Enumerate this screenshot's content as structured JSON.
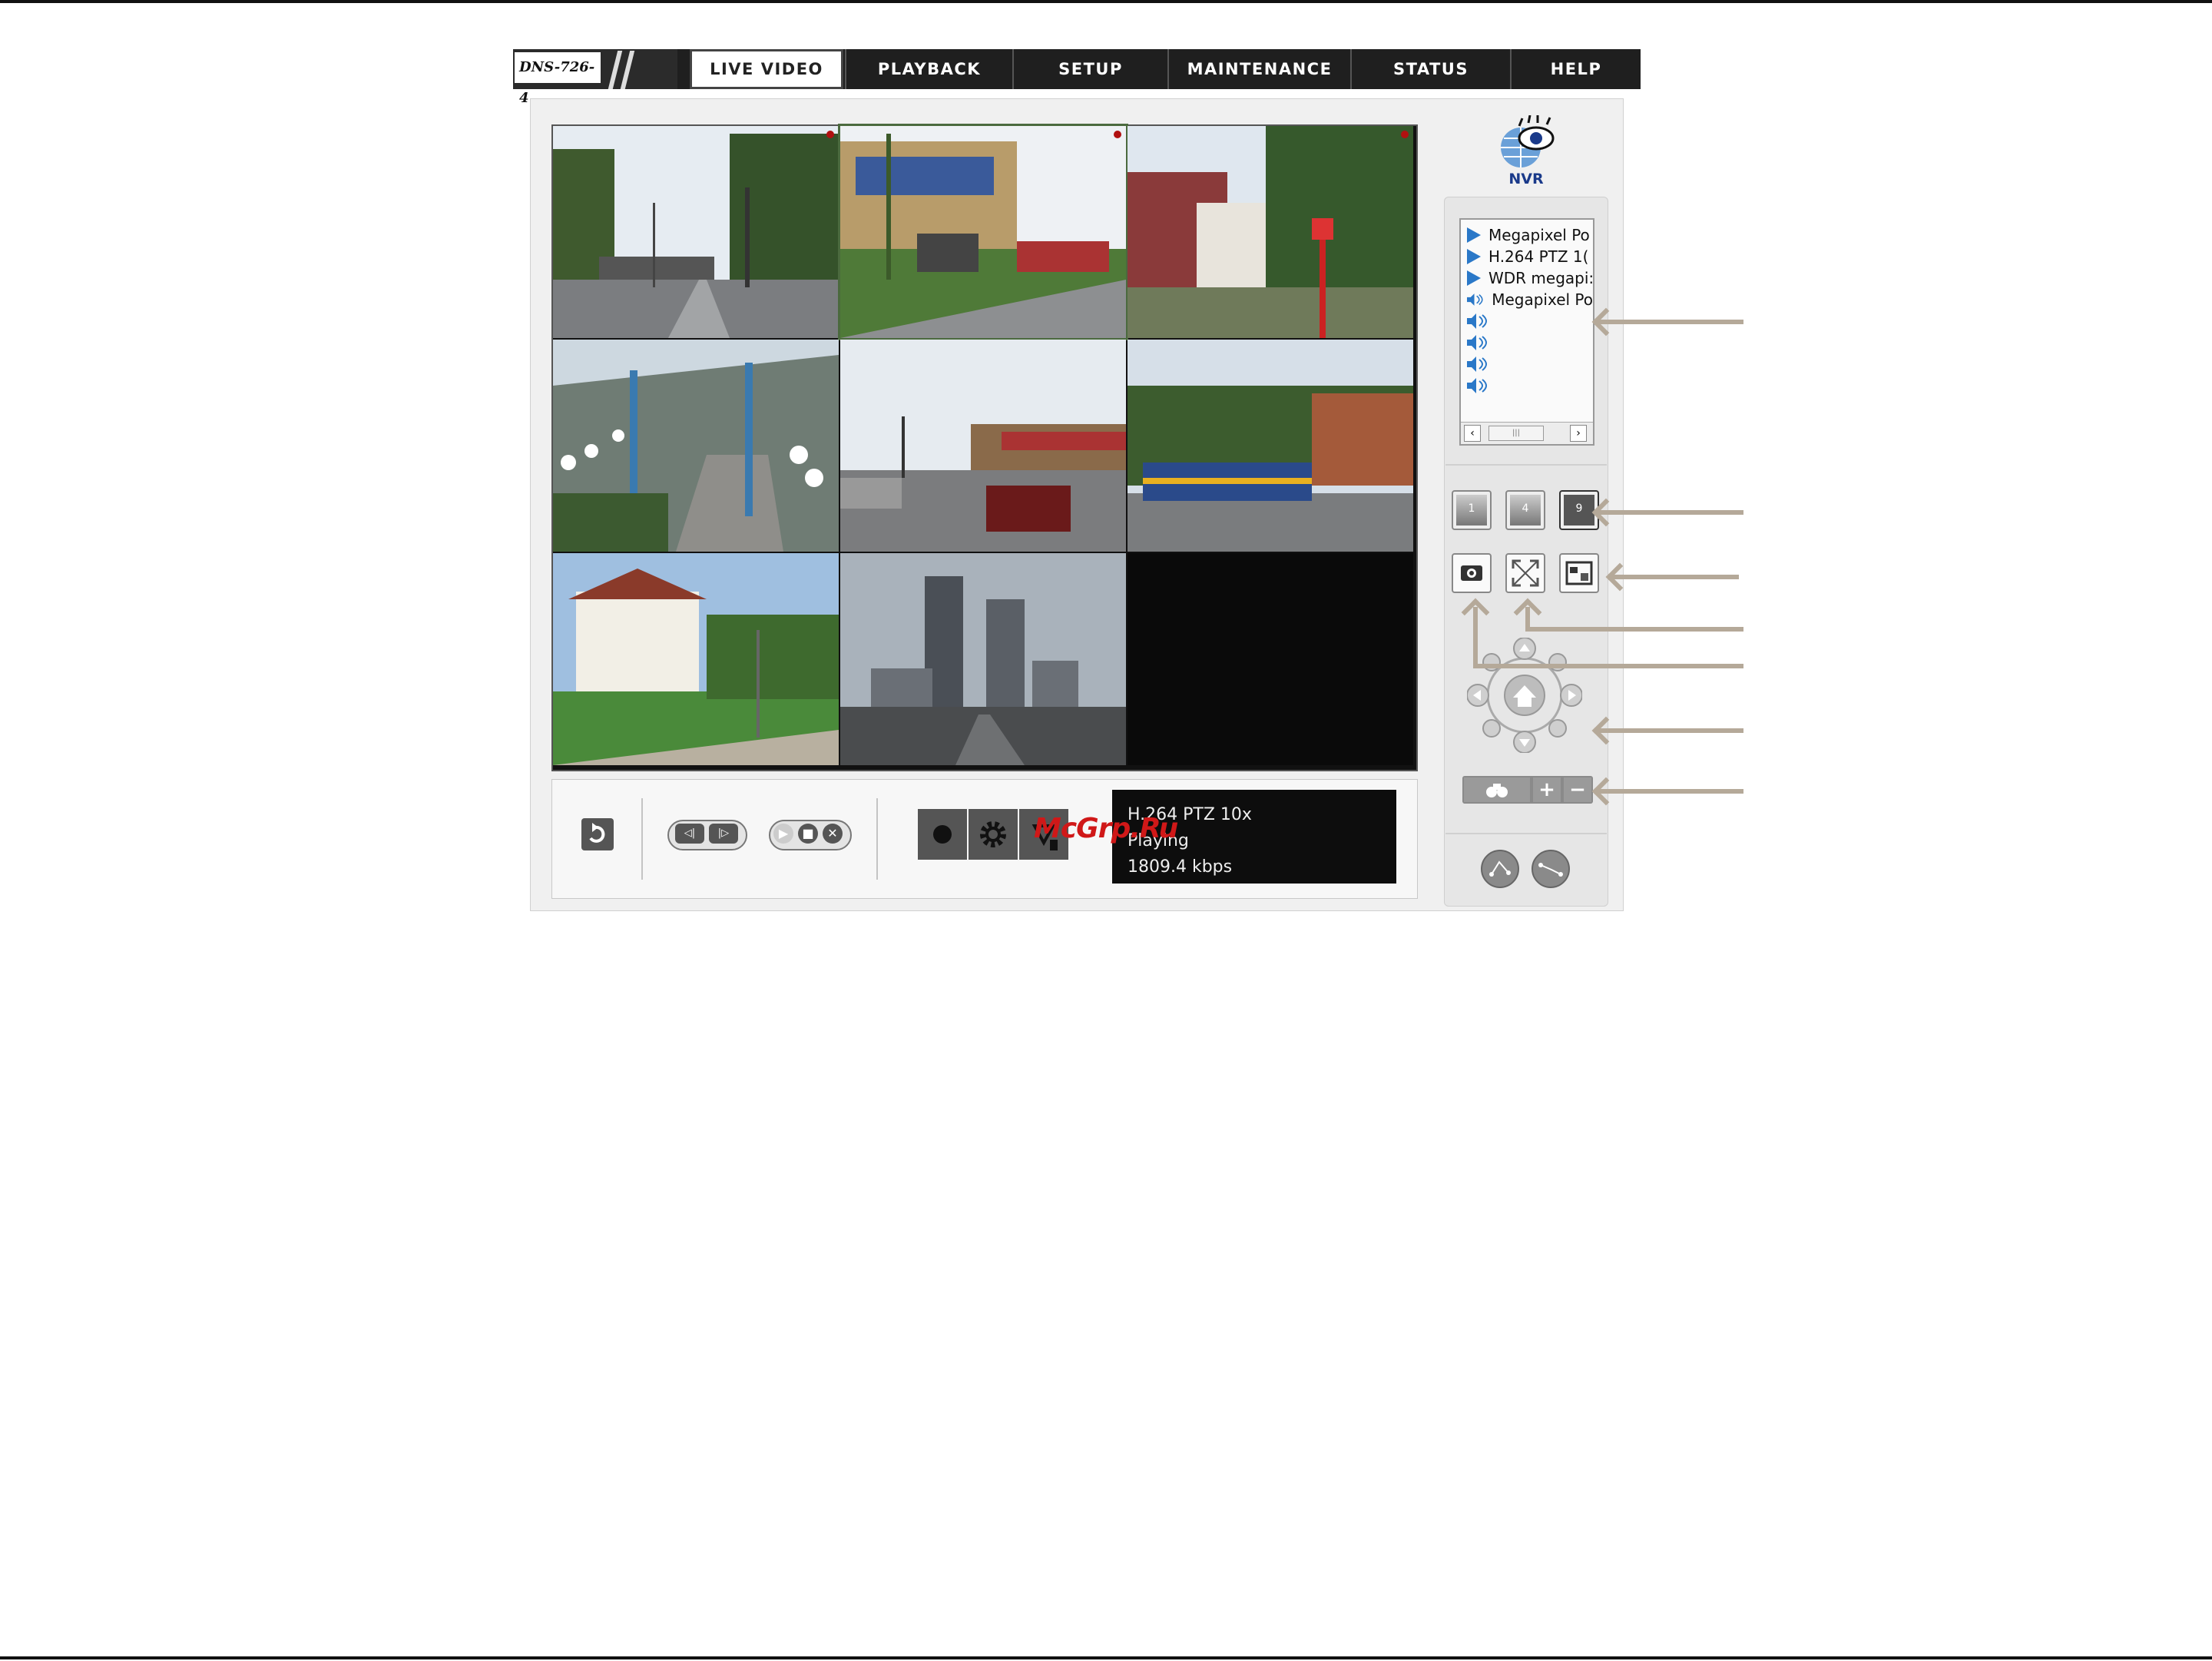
{
  "header": {
    "model": "DNS-726-4",
    "tabs": [
      "LIVE VIDEO",
      "PLAYBACK",
      "SETUP",
      "MAINTENANCE",
      "STATUS",
      "HELP"
    ],
    "active_tab": "LIVE VIDEO"
  },
  "brand": {
    "label": "NVR"
  },
  "camera_list": {
    "items": [
      {
        "label": "Megapixel Po",
        "icon": "play-icon"
      },
      {
        "label": "H.264 PTZ 1(",
        "icon": "play-icon"
      },
      {
        "label": "WDR megapi:",
        "icon": "play-icon"
      },
      {
        "label": "Megapixel Po",
        "icon": "speaker-icon"
      },
      {
        "label": "",
        "icon": "speaker-icon"
      },
      {
        "label": "",
        "icon": "speaker-icon"
      },
      {
        "label": "",
        "icon": "speaker-icon"
      },
      {
        "label": "",
        "icon": "speaker-icon"
      }
    ]
  },
  "layout_buttons": [
    "1",
    "4",
    "9"
  ],
  "status": {
    "camera": "H.264 PTZ 10x",
    "state": "Playing",
    "bitrate": "1809.4 kbps"
  },
  "watermark": "McGrp.Ru",
  "colors": {
    "nav_bg": "#1f1f1f",
    "callout_arrow": "#b5a999",
    "list_play": "#2a78c8"
  }
}
